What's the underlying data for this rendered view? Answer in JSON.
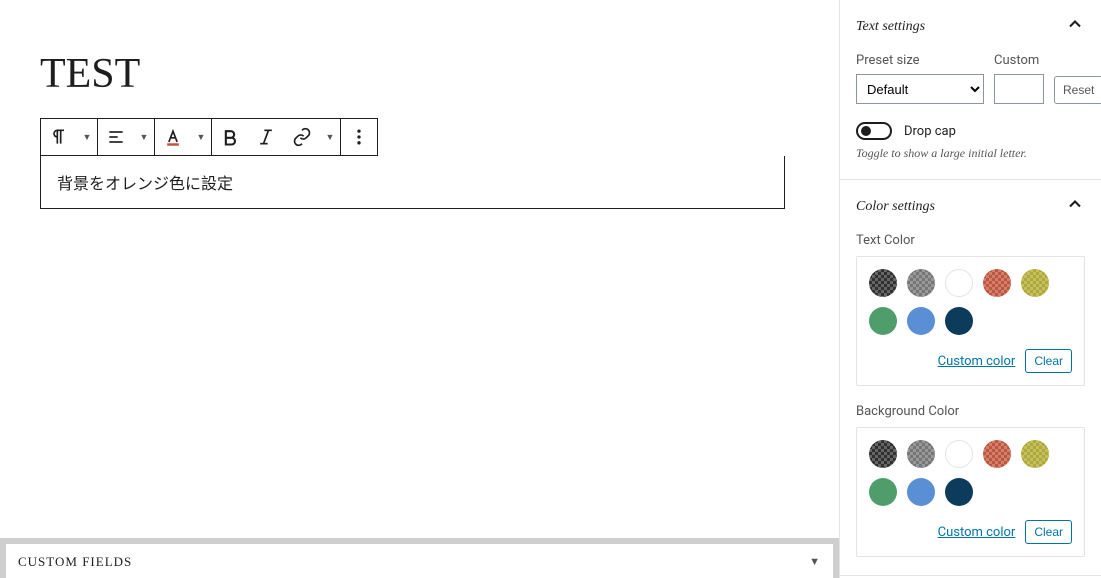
{
  "editor": {
    "post_title": "TEST",
    "paragraph_text": "背景をオレンジ色に設定"
  },
  "custom_fields": {
    "label": "Custom Fields"
  },
  "sidebar": {
    "text_settings": {
      "title": "Text settings",
      "preset_label": "Preset size",
      "preset_value": "Default",
      "custom_label": "Custom",
      "reset_label": "Reset",
      "dropcap_label": "Drop cap",
      "dropcap_hint": "Toggle to show a large initial letter."
    },
    "color_settings": {
      "title": "Color settings",
      "text_color_label": "Text Color",
      "background_color_label": "Background Color",
      "custom_color_label": "Custom color",
      "clear_label": "Clear",
      "palette": [
        {
          "name": "very-dark-gray",
          "hex": "#313131"
        },
        {
          "name": "gray",
          "hex": "#767676"
        },
        {
          "name": "white",
          "hex": "#ffffff"
        },
        {
          "name": "red",
          "hex": "#c0553e"
        },
        {
          "name": "olive",
          "hex": "#b0a933"
        },
        {
          "name": "green",
          "hex": "#4f9d6b"
        },
        {
          "name": "blue",
          "hex": "#5a8fd6"
        },
        {
          "name": "dark-blue",
          "hex": "#0d3b5c"
        }
      ]
    }
  }
}
